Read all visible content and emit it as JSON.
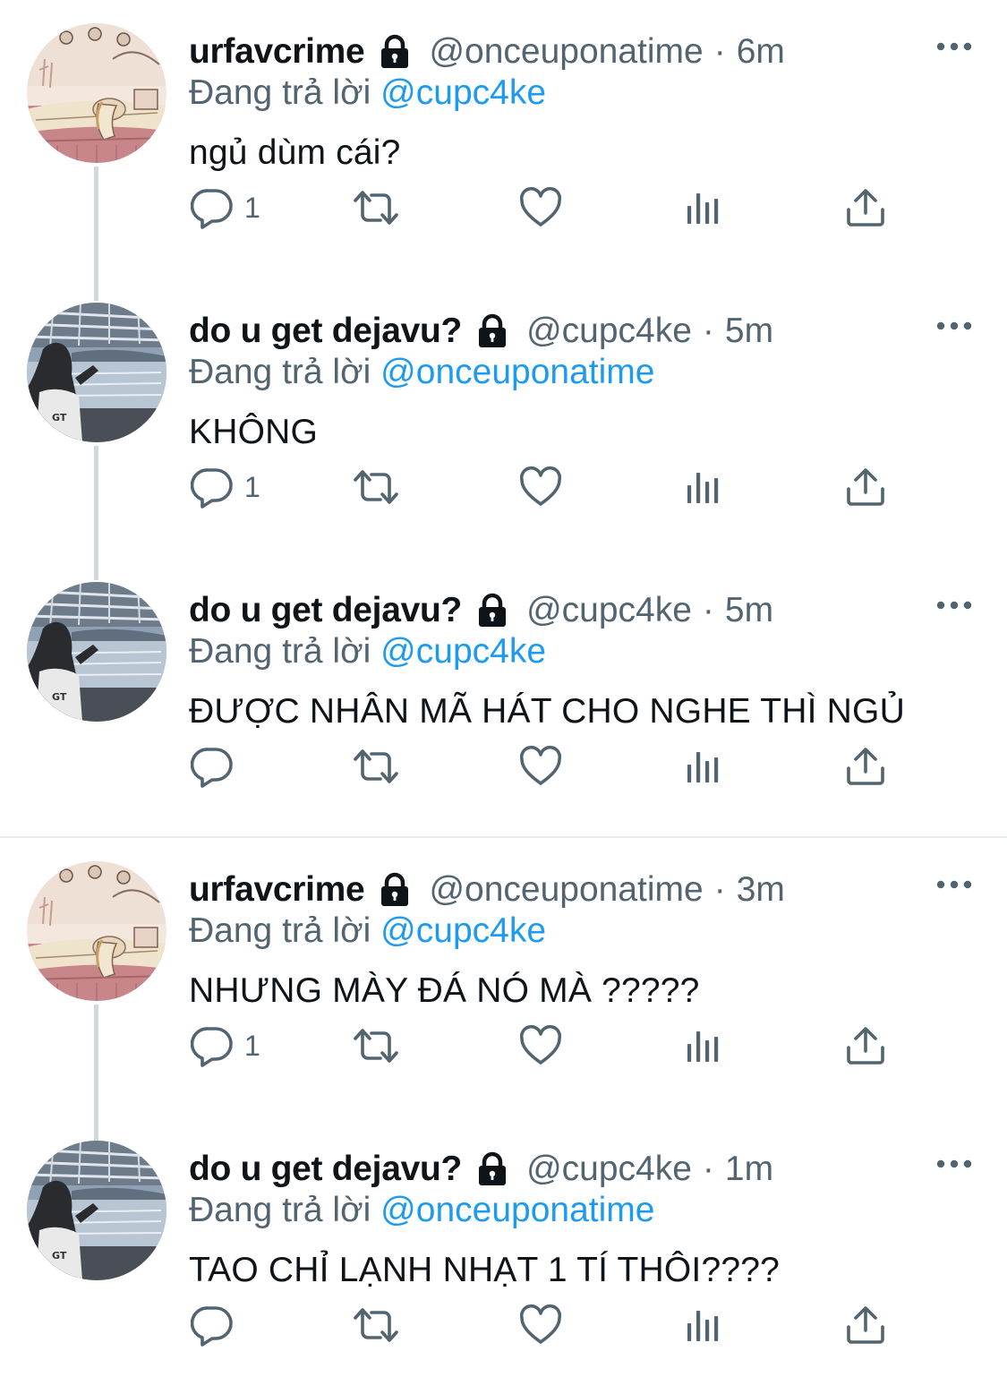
{
  "tweets": [
    {
      "avatar": "bedroom-illustration-avatar",
      "display_name": "urfavcrime",
      "handle": "@onceuponatime",
      "separator": "·",
      "time": "6m",
      "reply_prefix": "Đang trả lời",
      "reply_to": "@cupc4ke",
      "text": "ngủ dùm cái?",
      "reply_count": "1"
    },
    {
      "avatar": "seaside-photo-avatar",
      "display_name": "do u get dejavu?",
      "handle": "@cupc4ke",
      "separator": "·",
      "time": "5m",
      "reply_prefix": "Đang trả lời",
      "reply_to": "@onceuponatime",
      "text": "KHÔNG",
      "reply_count": "1"
    },
    {
      "avatar": "seaside-photo-avatar",
      "display_name": "do u get dejavu?",
      "handle": "@cupc4ke",
      "separator": "·",
      "time": "5m",
      "reply_prefix": "Đang trả lời",
      "reply_to": "@cupc4ke",
      "text": "ĐƯỢC NHÂN MÃ HÁT CHO NGHE THÌ NGỦ",
      "reply_count": ""
    },
    {
      "avatar": "bedroom-illustration-avatar",
      "display_name": "urfavcrime",
      "handle": "@onceuponatime",
      "separator": "·",
      "time": "3m",
      "reply_prefix": "Đang trả lời",
      "reply_to": "@cupc4ke",
      "text": "NHƯNG MÀY ĐÁ NÓ MÀ ?????",
      "reply_count": "1"
    },
    {
      "avatar": "seaside-photo-avatar",
      "display_name": "do u get dejavu?",
      "handle": "@cupc4ke",
      "separator": "·",
      "time": "1m",
      "reply_prefix": "Đang trả lời",
      "reply_to": "@onceuponatime",
      "text": "TAO CHỈ LẠNH NHẠT 1 TÍ THÔI????",
      "reply_count": ""
    }
  ],
  "icons": {
    "lock": "lock-icon",
    "more": "more-icon",
    "reply": "reply-icon",
    "retweet": "retweet-icon",
    "like": "heart-icon",
    "views": "views-icon",
    "share": "share-icon"
  },
  "colors": {
    "text": "#0f1419",
    "secondary": "#536471",
    "mention": "#1d9bf0",
    "thread_line": "#cfd9de",
    "divider": "#e6ecf0"
  }
}
